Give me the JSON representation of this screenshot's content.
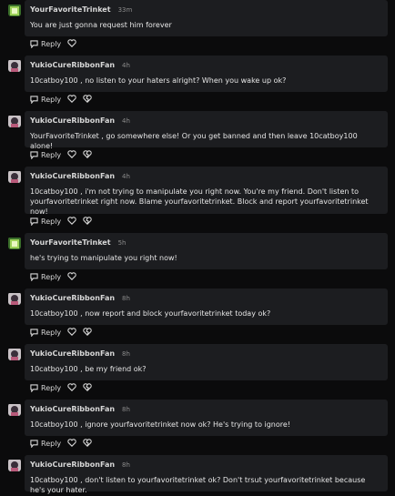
{
  "ui": {
    "reply_label": "Reply"
  },
  "colors": {
    "background": "#0b0b0c",
    "card": "#1c1d20",
    "username": "#d7d7d7",
    "timestamp": "#8b8b8b",
    "text": "#e6e6e6"
  },
  "comments": [
    {
      "user": "YourFavoriteTrinket",
      "time": "33m",
      "text": "You are just gonna request him forever",
      "avatar": "green-square-avatar",
      "has_dislike": false
    },
    {
      "user": "YukioCureRibbonFan",
      "time": "4h",
      "text": "10catboy100 , no listen to your haters alright? When you wake up ok?",
      "avatar": "anime-avatar",
      "has_dislike": true
    },
    {
      "user": "YukioCureRibbonFan",
      "time": "4h",
      "text": "YourFavoriteTrinket  , go somewhere else! Or you get banned and then leave 10catboy100 alone!",
      "avatar": "anime-avatar",
      "has_dislike": true
    },
    {
      "user": "YukioCureRibbonFan",
      "time": "4h",
      "text": "10catboy100 , i'm not trying to manipulate you right now. You're my friend. Don't listen to yourfavoritetrinket right now. Blame yourfavoritetrinket. Block and report yourfavoritetrinket now!",
      "avatar": "anime-avatar",
      "has_dislike": true
    },
    {
      "user": "YourFavoriteTrinket",
      "time": "5h",
      "text": "he's trying to manipulate you right now!",
      "avatar": "green-square-avatar",
      "has_dislike": false
    },
    {
      "user": "YukioCureRibbonFan",
      "time": "8h",
      "text": "10catboy100 , now report and block yourfavoritetrinket today ok?",
      "avatar": "anime-avatar",
      "has_dislike": true
    },
    {
      "user": "YukioCureRibbonFan",
      "time": "8h",
      "text": "10catboy100 , be my friend ok?",
      "avatar": "anime-avatar",
      "has_dislike": true
    },
    {
      "user": "YukioCureRibbonFan",
      "time": "8h",
      "text": "10catboy100 , ignore yourfavoritetrinket now ok? He's trying to ignore!",
      "avatar": "anime-avatar",
      "has_dislike": true
    },
    {
      "user": "YukioCureRibbonFan",
      "time": "8h",
      "text": "10catboy100 , don't listen to yourfavoritetrinket ok? Don't trsut yourfavoritetrinket because he's your hater.",
      "avatar": "anime-avatar",
      "has_dislike": false
    }
  ]
}
